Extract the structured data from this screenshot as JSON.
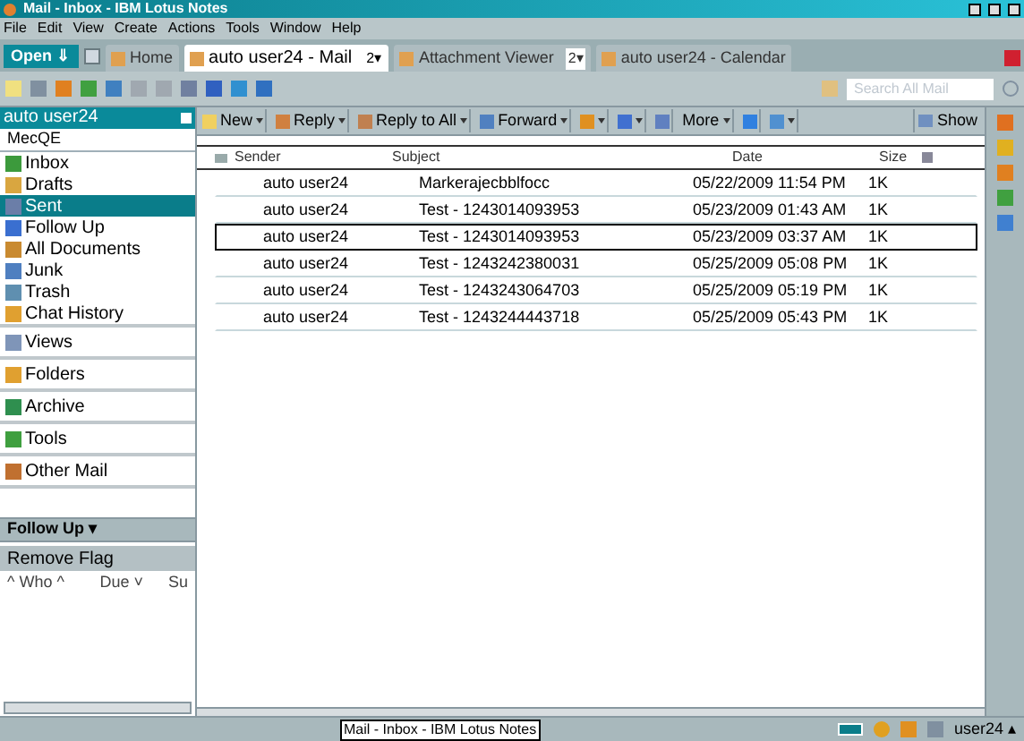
{
  "window": {
    "title": "Mail - Inbox - IBM Lotus Notes"
  },
  "menu": [
    "File",
    "Edit",
    "View",
    "Create",
    "Actions",
    "Tools",
    "Window",
    "Help"
  ],
  "open_button": "Open ⇓",
  "tabs": [
    {
      "label": "Home",
      "selected": false
    },
    {
      "label": "auto user24 - Mail",
      "selected": true,
      "count": "2▾"
    },
    {
      "label": "Attachment Viewer",
      "selected": false,
      "count": "2▾"
    },
    {
      "label": "auto user24 - Calendar",
      "selected": false
    }
  ],
  "search": {
    "placeholder": "Search All Mail"
  },
  "navigator": {
    "title": "auto user24",
    "subtitle": "MecQE",
    "items": [
      {
        "label": "Inbox",
        "selected": false
      },
      {
        "label": "Drafts",
        "selected": false
      },
      {
        "label": "Sent",
        "selected": true
      },
      {
        "label": "Follow Up",
        "selected": false
      },
      {
        "label": "All Documents",
        "selected": false
      },
      {
        "label": "Junk",
        "selected": false
      },
      {
        "label": "Trash",
        "selected": false
      },
      {
        "label": "Chat History",
        "selected": false
      }
    ],
    "sections": [
      "Views",
      "Folders",
      "Archive",
      "Tools",
      "Other Mail"
    ]
  },
  "follow_up": {
    "title": "Follow Up ▾",
    "action": "Remove Flag",
    "columns": [
      "^ Who ^",
      "Due ˅",
      "Su"
    ]
  },
  "toolbar": [
    {
      "label": "New",
      "dropdown": true
    },
    {
      "label": "Reply",
      "dropdown": true
    },
    {
      "label": "Reply to All",
      "dropdown": true
    },
    {
      "label": "Forward",
      "dropdown": true
    },
    {
      "dropdown": true
    },
    {
      "dropdown": true
    },
    {
      "dropdown": false
    },
    {
      "label": "More",
      "dropdown": true
    },
    {
      "dropdown": false
    },
    {
      "dropdown": true
    }
  ],
  "show_button": "Show",
  "table": {
    "columns": [
      "Sender",
      "Subject",
      "Date",
      "Size"
    ],
    "rows": [
      {
        "sender": "auto user24",
        "subject": "Markerajecbblfocc",
        "date": "05/22/2009 11:54 PM",
        "size": "1K",
        "selected": false
      },
      {
        "sender": "auto user24",
        "subject": "Test - 1243014093953",
        "date": "05/23/2009 01:43 AM",
        "size": "1K",
        "selected": false
      },
      {
        "sender": "auto user24",
        "subject": "Test - 1243014093953",
        "date": "05/23/2009 03:37 AM",
        "size": "1K",
        "selected": true
      },
      {
        "sender": "auto user24",
        "subject": "Test - 1243242380031",
        "date": "05/25/2009 05:08 PM",
        "size": "1K",
        "selected": false
      },
      {
        "sender": "auto user24",
        "subject": "Test - 1243243064703",
        "date": "05/25/2009 05:19 PM",
        "size": "1K",
        "selected": false
      },
      {
        "sender": "auto user24",
        "subject": "Test - 1243244443718",
        "date": "05/25/2009 05:43 PM",
        "size": "1K",
        "selected": false
      }
    ]
  },
  "status_bar": {
    "tooltip": "Mail - Inbox - IBM Lotus Notes",
    "user": "user24 ▴"
  }
}
